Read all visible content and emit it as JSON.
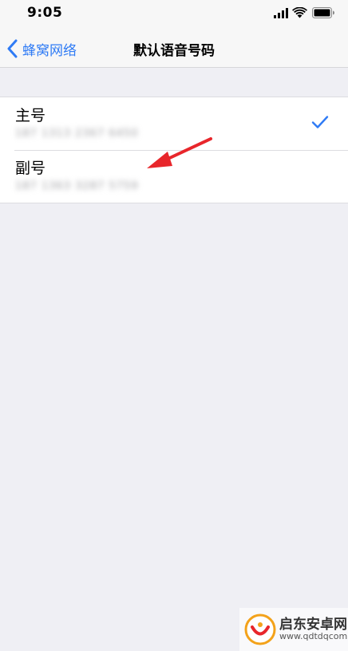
{
  "status_bar": {
    "time": "9:05",
    "icons": [
      "cellular-signal-icon",
      "wifi-icon",
      "battery-icon"
    ]
  },
  "nav": {
    "back_label": "蜂窝网络",
    "title": "默认语音号码"
  },
  "list": {
    "items": [
      {
        "label": "主号",
        "number": "187 1313 2367 6450",
        "selected": true
      },
      {
        "label": "副号",
        "number": "187 1363 3287 5759",
        "selected": false
      }
    ]
  },
  "colors": {
    "accent": "#2f7bf5",
    "background": "#efeff4",
    "annotation": "#e8262b"
  },
  "watermark": {
    "name": "启东安卓网",
    "url": "www.qdtdqcom"
  }
}
